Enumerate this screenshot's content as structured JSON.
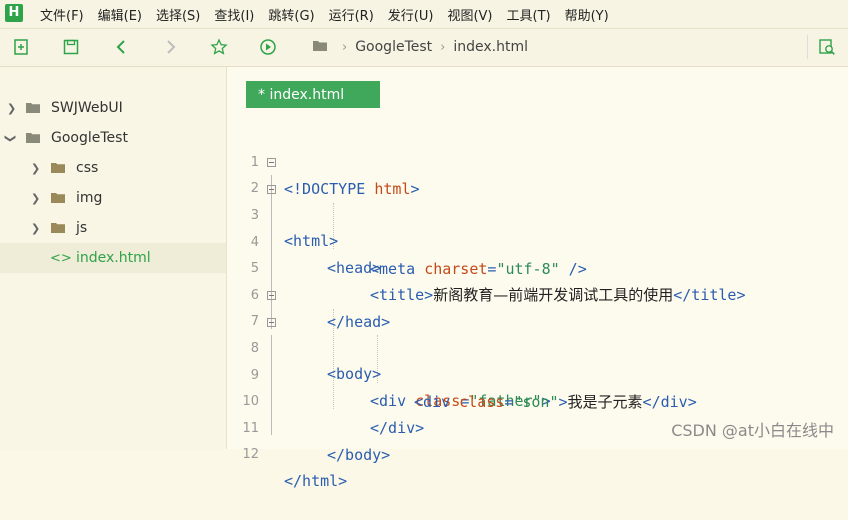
{
  "app": {
    "logo_text": "H"
  },
  "menu": [
    "文件(F)",
    "编辑(E)",
    "选择(S)",
    "查找(I)",
    "跳转(G)",
    "运行(R)",
    "发行(U)",
    "视图(V)",
    "工具(T)",
    "帮助(Y)"
  ],
  "breadcrumb": {
    "folder": "GoogleTest",
    "file": "index.html"
  },
  "sidebar": {
    "items": [
      {
        "label": "SWJWebUI",
        "type": "project",
        "expanded": false
      },
      {
        "label": "GoogleTest",
        "type": "project",
        "expanded": true
      },
      {
        "label": "css",
        "type": "folder",
        "expanded": false
      },
      {
        "label": "img",
        "type": "folder",
        "expanded": false
      },
      {
        "label": "js",
        "type": "folder",
        "expanded": false
      },
      {
        "label": "index.html",
        "type": "file",
        "icon": "<>",
        "selected": true
      }
    ]
  },
  "editor": {
    "tab_label": "* index.html",
    "lines": [
      {
        "n": "1",
        "fold": false,
        "indent": 0
      },
      {
        "n": "2",
        "fold": true,
        "indent": 0
      },
      {
        "n": "3",
        "fold": true,
        "indent": 1
      },
      {
        "n": "4",
        "fold": false,
        "indent": 2
      },
      {
        "n": "5",
        "fold": false,
        "indent": 2
      },
      {
        "n": "6",
        "fold": false,
        "indent": 1
      },
      {
        "n": "7",
        "fold": true,
        "indent": 1
      },
      {
        "n": "8",
        "fold": true,
        "indent": 2
      },
      {
        "n": "9",
        "fold": false,
        "indent": 3
      },
      {
        "n": "10",
        "fold": false,
        "indent": 2
      },
      {
        "n": "11",
        "fold": false,
        "indent": 1
      },
      {
        "n": "12",
        "fold": false,
        "indent": 0
      }
    ],
    "code": {
      "l1": {
        "a": "<!DOCTYPE ",
        "b": "html",
        "c": ">"
      },
      "l2": "<html>",
      "l3": "<head>",
      "l4": {
        "open": "<meta ",
        "attr": "charset",
        "eq": "=",
        "val": "\"utf-8\"",
        "close": " />"
      },
      "l5": {
        "open": "<title>",
        "text": "新阁教育—前端开发调试工具的使用",
        "close": "</title>"
      },
      "l6": "</head>",
      "l7": "<body>",
      "l8": {
        "open": "<div ",
        "attr": "class",
        "eq": "=",
        "val": "\"father\"",
        "close": ">"
      },
      "l9": {
        "open": "<div ",
        "attr": "class",
        "eq": "=",
        "val": "\"son\"",
        "close": ">",
        "text": "我是子元素",
        "end": "</div>"
      },
      "l10": "</div>",
      "l11": "</body>",
      "l12": "</html>"
    }
  },
  "watermark": "CSDN @at小白在线中",
  "colors": {
    "accent": "#3fa85b",
    "tag": "#2a5db0",
    "attr": "#c44a1a",
    "value": "#2e8b57"
  }
}
